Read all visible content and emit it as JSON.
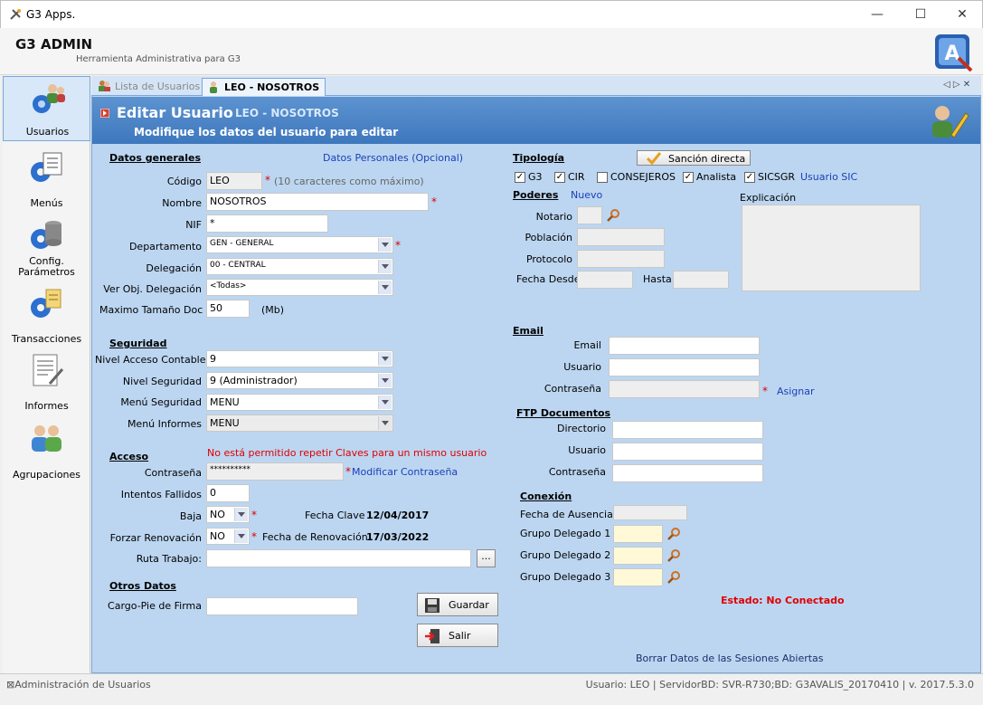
{
  "window": {
    "title": "G3 Apps.",
    "minimize": "—",
    "maximize": "☐",
    "close": "✕"
  },
  "app": {
    "title": "G3 ADMIN",
    "subtitle": "Herramienta Administrativa para G3"
  },
  "sidebar": {
    "items": [
      {
        "label": "Usuarios",
        "icon": "users-gear-icon"
      },
      {
        "label": "Menús",
        "icon": "menu-gear-icon"
      },
      {
        "label": "Config. Parámetros",
        "icon": "database-gear-icon"
      },
      {
        "label": "Transacciones",
        "icon": "transactions-gear-icon"
      },
      {
        "label": "Informes",
        "icon": "report-icon"
      },
      {
        "label": "Agrupaciones",
        "icon": "groups-icon"
      }
    ]
  },
  "tabs": [
    {
      "label": "Lista de Usuarios"
    },
    {
      "label": "LEO - NOSOTROS"
    }
  ],
  "tab_nav": "◁ ▷ ✕",
  "banner": {
    "title": "Editar Usuario",
    "name": "LEO - NOSOTROS",
    "subtitle": "Modifique los datos del usuario para editar"
  },
  "datos_generales": {
    "section": "Datos generales",
    "personal_link": "Datos Personales (Opcional)",
    "codigo_label": "Código",
    "codigo_value": "LEO",
    "codigo_hint": "(10 caracteres como máximo)",
    "nombre_label": "Nombre",
    "nombre_value": "NOSOTROS",
    "nif_label": "NIF",
    "nif_value": "*",
    "departamento_label": "Departamento",
    "departamento_value": "GEN - GENERAL",
    "delegacion_label": "Delegación",
    "delegacion_value": "00 - CENTRAL",
    "ver_obj_label": "Ver Obj. Delegación",
    "ver_obj_value": "<Todas>",
    "max_doc_label": "Maximo Tamaño Doc",
    "max_doc_value": "50",
    "max_doc_unit": "(Mb)"
  },
  "seguridad": {
    "section": "Seguridad",
    "nivel_contable_label": "Nivel Acceso Contable",
    "nivel_contable_value": "9",
    "nivel_seguridad_label": "Nivel Seguridad",
    "nivel_seguridad_value": "9 (Administrador)",
    "menu_seguridad_label": "Menú Seguridad",
    "menu_seguridad_value": "MENU",
    "menu_informes_label": "Menú Informes",
    "menu_informes_value": "MENU"
  },
  "acceso": {
    "section": "Acceso",
    "warning": "No está permitido repetir Claves para un mismo usuario",
    "contrasena_label": "Contraseña",
    "contrasena_value": "**********",
    "modificar_link": "Modificar Contraseña",
    "intentos_label": "Intentos Fallidos",
    "intentos_value": "0",
    "baja_label": "Baja",
    "baja_value": "NO",
    "fecha_clave_label": "Fecha Clave",
    "fecha_clave_value": "12/04/2017",
    "forzar_label": "Forzar Renovación",
    "forzar_value": "NO",
    "fecha_renov_label": "Fecha de Renovación",
    "fecha_renov_value": "17/03/2022",
    "ruta_label": "Ruta Trabajo:",
    "ruta_value": "",
    "browse": "..."
  },
  "otros": {
    "section": "Otros Datos",
    "cargo_label": "Cargo-Pie de Firma",
    "cargo_value": ""
  },
  "buttons": {
    "guardar": "Guardar",
    "salir": "Salir"
  },
  "tipologia": {
    "section": "Tipología",
    "sancion_button": "Sanción directa",
    "checks": [
      {
        "label": "G3",
        "checked": true
      },
      {
        "label": "CIR",
        "checked": true
      },
      {
        "label": "CONSEJEROS",
        "checked": false
      },
      {
        "label": "Analista",
        "checked": true
      },
      {
        "label": "SICSGR",
        "checked": true
      }
    ],
    "usuario_sic": "Usuario SIC"
  },
  "poderes": {
    "section": "Poderes",
    "nuevo": "Nuevo",
    "notario_label": "Notario",
    "poblacion_label": "Población",
    "protocolo_label": "Protocolo",
    "fecha_desde_label": "Fecha Desde",
    "hasta_label": "Hasta",
    "explicacion_label": "Explicación"
  },
  "email": {
    "section": "Email",
    "email_label": "Email",
    "usuario_label": "Usuario",
    "contrasena_label": "Contraseña",
    "asignar": "Asignar"
  },
  "ftp": {
    "section": "FTP Documentos",
    "directorio_label": "Directorio",
    "usuario_label": "Usuario",
    "contrasena_label": "Contraseña"
  },
  "conexion": {
    "section": "Conexión",
    "ausencia_label": "Fecha de Ausencia",
    "grupo1_label": "Grupo Delegado 1",
    "grupo2_label": "Grupo Delegado 2",
    "grupo3_label": "Grupo Delegado 3",
    "estado": "Estado: No Conectado",
    "borrar": "Borrar Datos de las Sesiones Abiertas"
  },
  "statusbar": {
    "left": "Administración de Usuarios",
    "right": "Usuario: LEO  |  ServidorBD: SVR-R730;BD: G3AVALIS_20170410  |  v. 2017.5.3.0"
  },
  "colors": {
    "panel": "#bcd6f1",
    "banner": "#4a84c7",
    "required": "#e00000",
    "link": "#1b3fb8"
  }
}
